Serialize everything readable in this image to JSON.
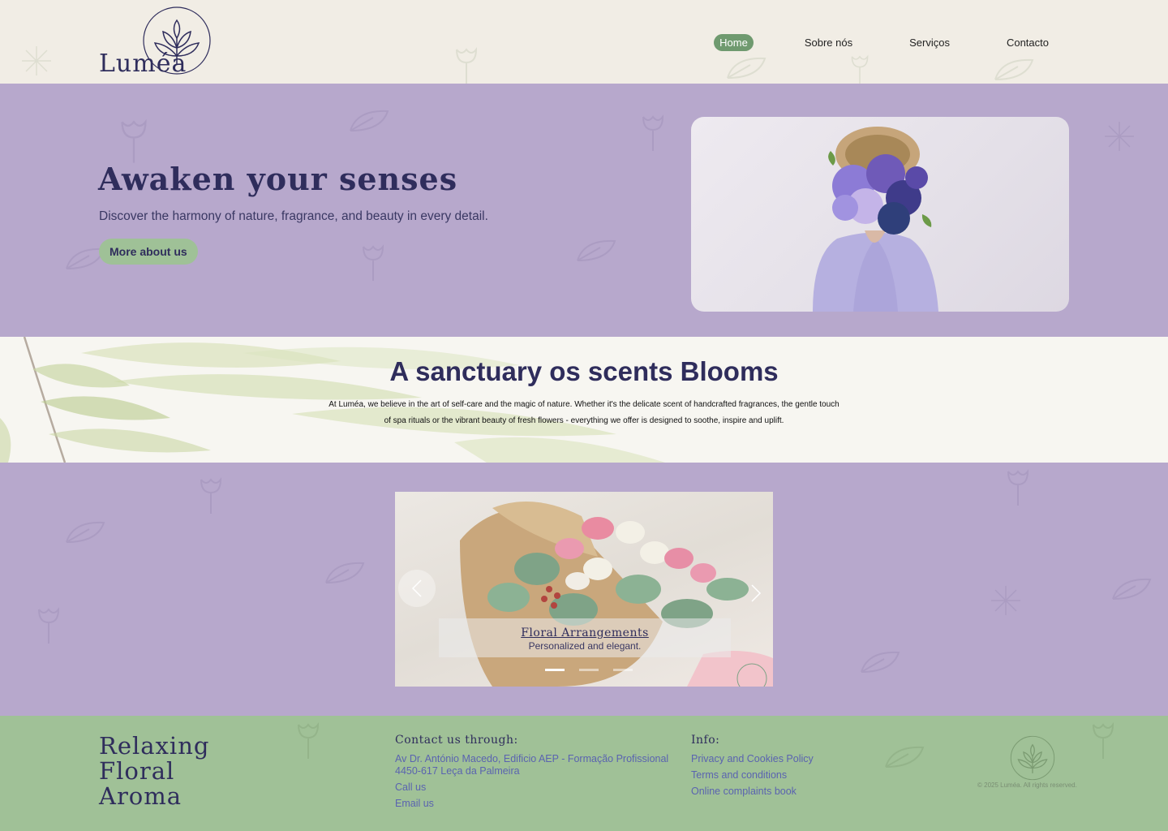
{
  "header": {
    "logo_text": "Luméa",
    "nav": [
      {
        "label": "Home",
        "active": true
      },
      {
        "label": "Sobre nós",
        "active": false
      },
      {
        "label": "Serviços",
        "active": false
      },
      {
        "label": "Contacto",
        "active": false
      }
    ]
  },
  "hero": {
    "title": "Awaken your senses",
    "subtitle": "Discover the harmony of nature, fragrance, and beauty in every detail.",
    "button_label": "More about us"
  },
  "about": {
    "title": "A sanctuary os scents  Blooms",
    "text": "At Luméa, we believe in the art of self-care and the magic of nature. Whether it's the delicate scent of handcrafted fragrances, the gentle touch of spa rituals or the vibrant beauty of fresh flowers - everything we offer is designed to soothe, inspire and uplift."
  },
  "carousel": {
    "slide_title": "Floral Arrangements",
    "slide_subtitle": "Personalized and elegant.",
    "slide_count": 3,
    "active_slide": 0
  },
  "footer": {
    "tagline_lines": [
      "Relaxing",
      "Floral",
      "Aroma"
    ],
    "contact": {
      "heading": "Contact us through:",
      "address_line1": "Av Dr. António Macedo, Edificio AEP - Formação Profissional",
      "address_line2": "4450-617 Leça da Palmeira",
      "call": "Call us",
      "email": "Email us"
    },
    "info": {
      "heading": "Info:",
      "links": [
        "Privacy and Cookies Policy",
        "Terms and conditions",
        "Online complaints book"
      ]
    },
    "copyright": "© 2025 Luméa. All rights reserved."
  },
  "colors": {
    "lavender": "#b7a8cc",
    "sage": "#a0c197",
    "cream": "#f1ede5",
    "navy": "#2f2d5c",
    "button_green": "#6f9a6f"
  },
  "icons": [
    "lotus-logo-icon",
    "chevron-left-icon",
    "chevron-right-icon"
  ]
}
